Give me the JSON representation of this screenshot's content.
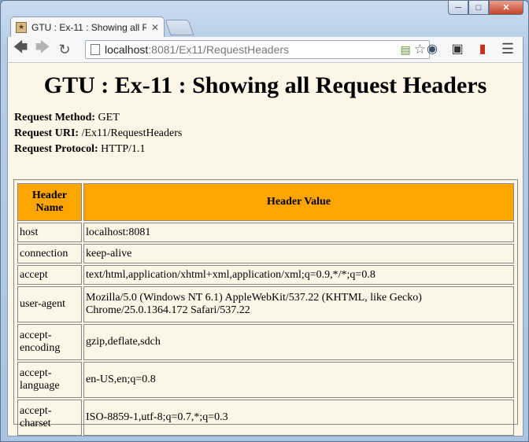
{
  "browser": {
    "tab_title": "GTU : Ex-11 : Showing all R",
    "url_host": "localhost",
    "url_rest": ":8081/Ex11/RequestHeaders"
  },
  "page": {
    "heading": "GTU : Ex-11 : Showing all Request Headers",
    "method_label": "Request Method:",
    "method_value": "GET",
    "uri_label": "Request URI:",
    "uri_value": "/Ex11/RequestHeaders",
    "protocol_label": "Request Protocol:",
    "protocol_value": "HTTP/1.1"
  },
  "table": {
    "header_name": "Header Name",
    "header_value": "Header Value",
    "rows": [
      {
        "name": "host",
        "value": "localhost:8081"
      },
      {
        "name": "connection",
        "value": "keep-alive"
      },
      {
        "name": "accept",
        "value": "text/html,application/xhtml+xml,application/xml;q=0.9,*/*;q=0.8"
      },
      {
        "name": "user-agent",
        "value": "Mozilla/5.0 (Windows NT 6.1) AppleWebKit/537.22 (KHTML, like Gecko) Chrome/25.0.1364.172 Safari/537.22"
      },
      {
        "name": "accept-encoding",
        "value": "gzip,deflate,sdch"
      },
      {
        "name": "accept-language",
        "value": "en-US,en;q=0.8"
      },
      {
        "name": "accept-charset",
        "value": "ISO-8859-1,utf-8;q=0.7,*;q=0.3"
      }
    ]
  },
  "icons": {
    "back": "back-arrow-icon",
    "forward": "forward-arrow-icon",
    "reload": "reload-icon",
    "star": "star-icon",
    "menu": "menu-icon"
  },
  "colors": {
    "table_header_bg": "#ffa500",
    "page_bg": "#fdf5e6"
  }
}
